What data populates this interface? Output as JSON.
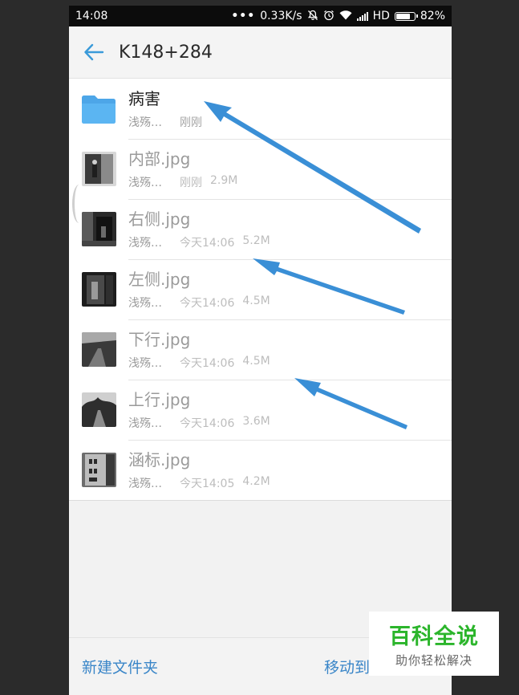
{
  "status_bar": {
    "time": "14:08",
    "dots": "•••",
    "network_speed": "0.33K/s",
    "hd": "HD",
    "battery": "82%",
    "battery_level": 0.82,
    "icons": [
      "mute-icon",
      "alarm-icon",
      "wifi-icon",
      "signal-icon",
      "battery-icon"
    ]
  },
  "header": {
    "title": "K148+284",
    "back_icon": "arrow-left-icon",
    "accent_color": "#3a9ad9"
  },
  "files": [
    {
      "name": "病害",
      "owner": "浅殇…",
      "time": "刚刚",
      "size": "",
      "type": "folder"
    },
    {
      "name": "内部.jpg",
      "owner": "浅殇…",
      "time": "刚刚",
      "size": "2.9M",
      "type": "image"
    },
    {
      "name": "右侧.jpg",
      "owner": "浅殇…",
      "time": "今天14:06",
      "size": "5.2M",
      "type": "image"
    },
    {
      "name": "左侧.jpg",
      "owner": "浅殇…",
      "time": "今天14:06",
      "size": "4.5M",
      "type": "image"
    },
    {
      "name": "下行.jpg",
      "owner": "浅殇…",
      "time": "今天14:06",
      "size": "4.5M",
      "type": "image"
    },
    {
      "name": "上行.jpg",
      "owner": "浅殇…",
      "time": "今天14:06",
      "size": "3.6M",
      "type": "image"
    },
    {
      "name": "涵标.jpg",
      "owner": "浅殇…",
      "time": "今天14:05",
      "size": "4.2M",
      "type": "image"
    }
  ],
  "bottom_bar": {
    "new_folder": "新建文件夹",
    "move_to": "移动到"
  },
  "watermark": {
    "title": "百科全说",
    "subtitle": "助你轻松解决",
    "color": "#2bb52b"
  },
  "annotation_color": "#3a8fd6"
}
